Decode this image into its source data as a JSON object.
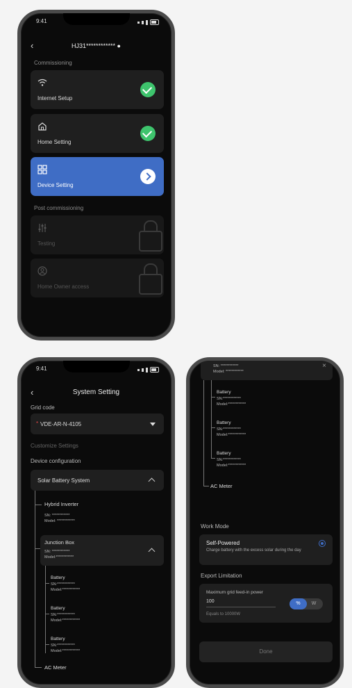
{
  "phone1": {
    "time": "9:41",
    "header_title": "HJ31************ ●",
    "section_commissioning": "Commissioning",
    "items": [
      {
        "label": "Internet Setup",
        "icon": "wifi-icon",
        "state": "done"
      },
      {
        "label": "Home Setting",
        "icon": "home-icon",
        "state": "done"
      },
      {
        "label": "Device Setting",
        "icon": "grid-icon",
        "state": "active"
      }
    ],
    "section_post": "Post commissioning",
    "post_items": [
      {
        "label": "Testing",
        "icon": "sliders-icon",
        "state": "locked"
      },
      {
        "label": "Home Owner access",
        "icon": "user-icon",
        "state": "locked"
      }
    ]
  },
  "phone2": {
    "time": "9:41",
    "title": "System Setting",
    "grid_code_label": "Grid code",
    "grid_code_value": "VDE-AR-N-4105",
    "grid_code_marker": "*",
    "customize_label": "Customize Settings",
    "device_config_label": "Device configuration",
    "system_value": "Solar Battery System",
    "hybrid_inverter": {
      "title": "Hybrid Inverter",
      "sn": "SN: ************",
      "model": "Model: ************"
    },
    "junction_box": {
      "title": "Junction Box",
      "sn": "SN: ************",
      "model": "Model:************"
    },
    "batteries": [
      {
        "title": "Battery",
        "sn": "SN:************",
        "model": "Model:************"
      },
      {
        "title": "Battery",
        "sn": "SN:************",
        "model": "Model:************"
      },
      {
        "title": "Battery",
        "sn": "SN:************",
        "model": "Model:************"
      }
    ],
    "ac_meter": "AC Meter"
  },
  "phone3": {
    "top_sn": "SN: ************",
    "top_model": "Model: ************",
    "batteries": [
      {
        "title": "Battery",
        "sn": "SN:************",
        "model": "Model:************"
      },
      {
        "title": "Battery",
        "sn": "SN:************",
        "model": "Model:************"
      },
      {
        "title": "Battery",
        "sn": "SN:************",
        "model": "Model:************"
      }
    ],
    "ac_meter": "AC Meter",
    "work_mode_label": "Work Mode",
    "work_mode_title": "Self-Powered",
    "work_mode_desc": "Charge battery with the excess solar during the day",
    "export_label": "Export Limitation",
    "max_feed_label": "Maximum grid feed-in power",
    "max_feed_value": "100",
    "unit_percent": "%",
    "unit_w": "W",
    "equals_text": "Equals to 10000W",
    "done_label": "Done"
  },
  "colors": {
    "accent": "#3f6dc5",
    "success": "#3ec46d",
    "card": "#1f1f1f",
    "bg": "#0b0b0b"
  }
}
